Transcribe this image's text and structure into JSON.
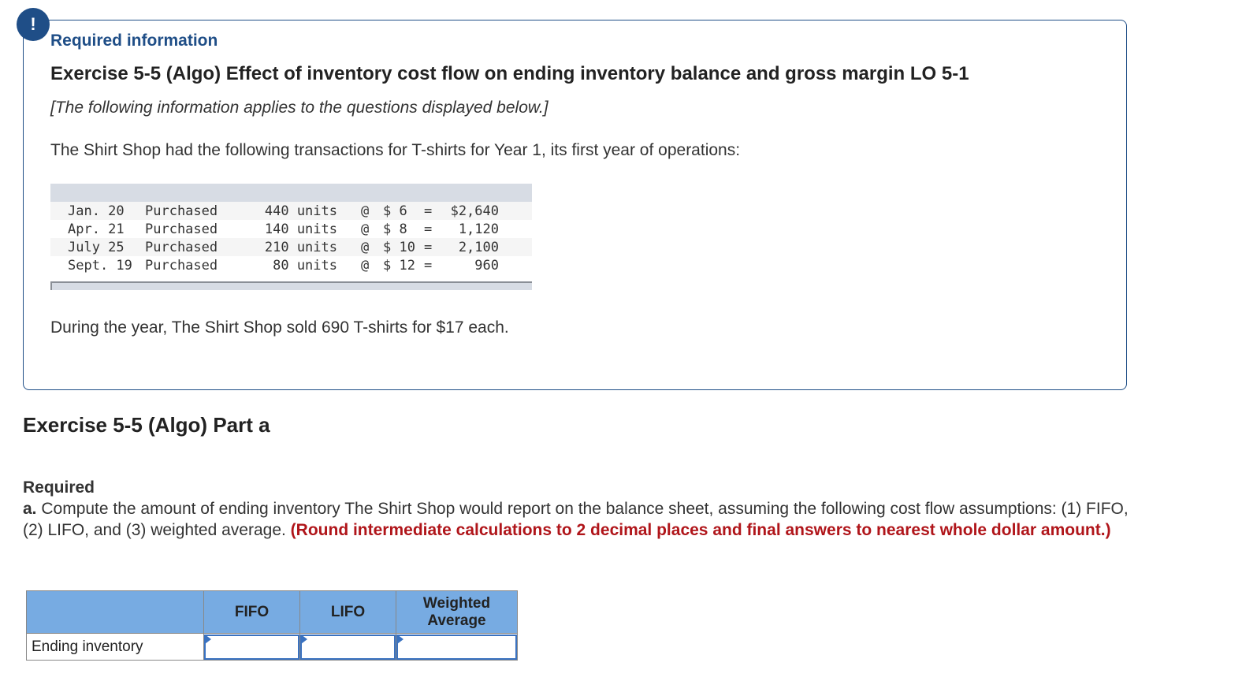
{
  "alert_icon": "exclamation-icon",
  "info": {
    "required_information": "Required information",
    "exercise_title": "Exercise 5-5 (Algo) Effect of inventory cost flow on ending inventory balance and gross margin LO 5-1",
    "applies_note": "[The following information applies to the questions displayed below.]",
    "intro": "The Shirt Shop had the following transactions for T-shirts for Year 1, its first year of operations:",
    "transactions": [
      {
        "date": "Jan. 20",
        "type": "Purchased",
        "units": "440 units",
        "at": "@",
        "price": "$ 6",
        "eq": "=",
        "total": "$2,640"
      },
      {
        "date": "Apr. 21",
        "type": "Purchased",
        "units": "140 units",
        "at": "@",
        "price": "$ 8",
        "eq": "=",
        "total": "1,120"
      },
      {
        "date": "July 25",
        "type": "Purchased",
        "units": "210 units",
        "at": "@",
        "price": "$ 10",
        "eq": "=",
        "total": "2,100"
      },
      {
        "date": "Sept. 19",
        "type": "Purchased",
        "units": "80 units",
        "at": "@",
        "price": "$ 12",
        "eq": "=",
        "total": "960"
      }
    ],
    "sold_note": "During the year, The Shirt Shop sold 690 T-shirts for $17 each."
  },
  "part": {
    "title": "Exercise 5-5 (Algo) Part a",
    "required_label": "Required",
    "item_letter": "a.",
    "item_text": " Compute the amount of ending inventory The Shirt Shop would report on the balance sheet, assuming the following cost flow assumptions: (1) FIFO, (2) LIFO, and (3) weighted average. ",
    "item_instruction": "(Round intermediate calculations to 2 decimal places and final answers to nearest whole dollar amount.)"
  },
  "answer_table": {
    "headers": [
      "",
      "FIFO",
      "LIFO",
      "Weighted Average"
    ],
    "rows": [
      {
        "label": "Ending inventory",
        "values": [
          "",
          "",
          ""
        ]
      }
    ]
  },
  "colors": {
    "brand_blue": "#1f4e87",
    "instruction_red": "#b0151a",
    "table_header_blue": "#77abe2"
  }
}
